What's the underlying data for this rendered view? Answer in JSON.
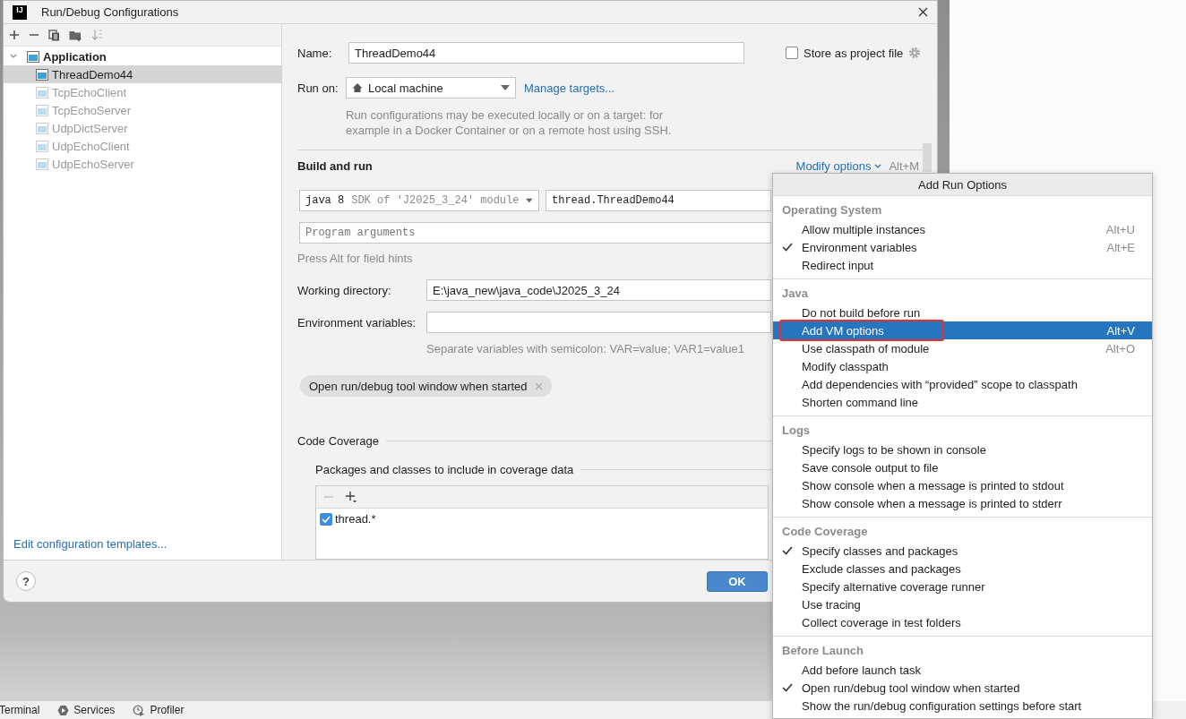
{
  "window": {
    "logo_text": "IJ",
    "title": "Run/Debug Configurations"
  },
  "tree": [
    {
      "label": "Application",
      "expanded": true,
      "selected": false,
      "faded": false,
      "children": [
        {
          "label": "ThreadDemo44",
          "selected": true,
          "faded": false
        },
        {
          "label": "TcpEchoClient",
          "selected": false,
          "faded": true
        },
        {
          "label": "TcpEchoServer",
          "selected": false,
          "faded": true
        },
        {
          "label": "UdpDictServer",
          "selected": false,
          "faded": true
        },
        {
          "label": "UdpEchoClient",
          "selected": false,
          "faded": true
        },
        {
          "label": "UdpEchoServer",
          "selected": false,
          "faded": true
        }
      ]
    }
  ],
  "templates_link": "Edit configuration templates...",
  "form": {
    "name_label": "Name:",
    "name_value": "ThreadDemo44",
    "store_label": "Store as project file",
    "store_checked": false,
    "run_on_label": "Run on:",
    "run_on_value": "Local machine",
    "manage_link": "Manage targets...",
    "run_on_hint": "Run configurations may be executed locally or on a target: for example in a Docker Container or on a remote host using SSH.",
    "build_title": "Build and run",
    "modify_link": "Modify options",
    "modify_shortcut": "Alt+M",
    "sdk_main": "java 8",
    "sdk_detail": "SDK of 'J2025_3_24' module",
    "main_class": "thread.ThreadDemo44",
    "args_placeholder": "Program arguments",
    "alt_hint": "Press Alt for field hints",
    "wd_label": "Working directory:",
    "wd_value": "E:\\java_new\\java_code\\J2025_3_24",
    "env_label": "Environment variables:",
    "env_hint": "Separate variables with semicolon: VAR=value; VAR1=value1",
    "chips": [
      "Open run/debug tool window when started"
    ],
    "coverage_title": "Code Coverage",
    "packages_title": "Packages and classes to include in coverage data",
    "packages": [
      {
        "label": "thread.*",
        "checked": true
      }
    ]
  },
  "footer": {
    "help": "?",
    "ok": "OK"
  },
  "popup": {
    "title": "Add Run Options",
    "sections": [
      {
        "title": "Operating System",
        "items": [
          {
            "label": "Allow multiple instances",
            "shortcut": "Alt+U",
            "checked": false,
            "selected": false,
            "annotated": false
          },
          {
            "label": "Environment variables",
            "shortcut": "Alt+E",
            "checked": true,
            "selected": false,
            "annotated": false
          },
          {
            "label": "Redirect input",
            "checked": false,
            "selected": false,
            "annotated": false
          }
        ]
      },
      {
        "title": "Java",
        "items": [
          {
            "label": "Do not build before run",
            "checked": false,
            "selected": false,
            "annotated": false
          },
          {
            "label": "Add VM options",
            "shortcut": "Alt+V",
            "checked": false,
            "selected": true,
            "annotated": true
          },
          {
            "label": "Use classpath of module",
            "shortcut": "Alt+O",
            "checked": false,
            "selected": false,
            "annotated": false
          },
          {
            "label": "Modify classpath",
            "checked": false,
            "selected": false,
            "annotated": false
          },
          {
            "label": "Add dependencies with “provided” scope to classpath",
            "checked": false,
            "selected": false,
            "annotated": false
          },
          {
            "label": "Shorten command line",
            "checked": false,
            "selected": false,
            "annotated": false
          }
        ]
      },
      {
        "title": "Logs",
        "items": [
          {
            "label": "Specify logs to be shown in console",
            "checked": false,
            "selected": false,
            "annotated": false
          },
          {
            "label": "Save console output to file",
            "checked": false,
            "selected": false,
            "annotated": false
          },
          {
            "label": "Show console when a message is printed to stdout",
            "checked": false,
            "selected": false,
            "annotated": false
          },
          {
            "label": "Show console when a message is printed to stderr",
            "checked": false,
            "selected": false,
            "annotated": false
          }
        ]
      },
      {
        "title": "Code Coverage",
        "items": [
          {
            "label": "Specify classes and packages",
            "checked": true,
            "selected": false,
            "annotated": false
          },
          {
            "label": "Exclude classes and packages",
            "checked": false,
            "selected": false,
            "annotated": false
          },
          {
            "label": "Specify alternative coverage runner",
            "checked": false,
            "selected": false,
            "annotated": false
          },
          {
            "label": "Use tracing",
            "checked": false,
            "selected": false,
            "annotated": false
          },
          {
            "label": "Collect coverage in test folders",
            "checked": false,
            "selected": false,
            "annotated": false
          }
        ]
      },
      {
        "title": "Before Launch",
        "items": [
          {
            "label": "Add before launch task",
            "checked": false,
            "selected": false,
            "annotated": false
          },
          {
            "label": "Open run/debug tool window when started",
            "checked": true,
            "selected": false,
            "annotated": false
          },
          {
            "label": "Show the run/debug configuration settings before start",
            "checked": false,
            "selected": false,
            "annotated": false
          }
        ]
      }
    ]
  },
  "tool_tabs": [
    {
      "label": "Terminal",
      "kind": "terminal"
    },
    {
      "label": "Services",
      "kind": "services"
    },
    {
      "label": "Profiler",
      "kind": "profiler"
    }
  ]
}
